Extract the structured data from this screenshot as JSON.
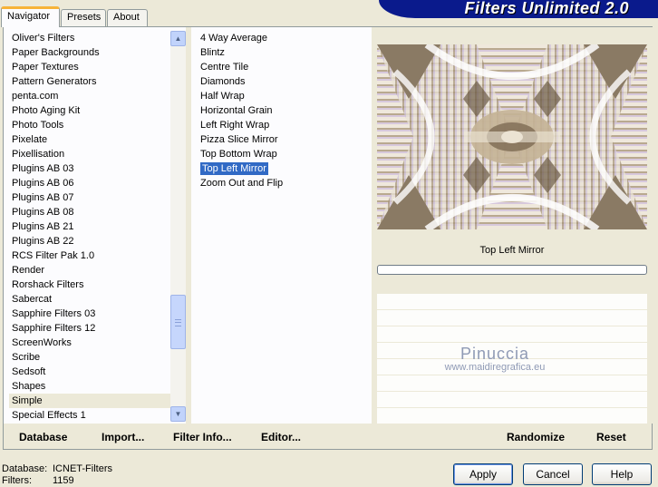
{
  "window": {
    "title": "Filters Unlimited 2.0"
  },
  "tabs": [
    {
      "label": "Navigator",
      "active": true
    },
    {
      "label": "Presets",
      "active": false
    },
    {
      "label": "About",
      "active": false
    }
  ],
  "categories": [
    "Oliver's Filters",
    "Paper Backgrounds",
    "Paper Textures",
    "Pattern Generators",
    "penta.com",
    "Photo Aging Kit",
    "Photo Tools",
    "Pixelate",
    "Pixellisation",
    "Plugins AB 03",
    "Plugins AB 06",
    "Plugins AB 07",
    "Plugins AB 08",
    "Plugins AB 21",
    "Plugins AB 22",
    "RCS Filter Pak 1.0",
    "Render",
    "Rorshack Filters",
    "Sabercat",
    "Sapphire Filters 03",
    "Sapphire Filters 12",
    "ScreenWorks",
    "Scribe",
    "Sedsoft",
    "Shapes",
    "Simple",
    "Special Effects 1"
  ],
  "selected_category": "Simple",
  "filters": [
    "4 Way Average",
    "Blintz",
    "Centre Tile",
    "Diamonds",
    "Half Wrap",
    "Horizontal Grain",
    "Left Right Wrap",
    "Pizza Slice Mirror",
    "Top Bottom Wrap",
    "Top Left Mirror",
    "Zoom Out and Flip"
  ],
  "selected_filter": "Top Left Mirror",
  "preview": {
    "effect_name": "Top Left Mirror",
    "progress": 0,
    "watermark_title": "Pinuccia",
    "watermark_url": "www.maidiregrafica.eu"
  },
  "bottom_buttons": {
    "database": "Database",
    "import": "Import...",
    "filter_info": "Filter Info...",
    "editor": "Editor...",
    "randomize": "Randomize",
    "reset": "Reset"
  },
  "status": {
    "database_label": "Database:",
    "database_value": "ICNET-Filters",
    "filters_label": "Filters:",
    "filters_value": "1159"
  },
  "dialog_buttons": {
    "apply": "Apply",
    "cancel": "Cancel",
    "help": "Help"
  },
  "icons": {
    "scroll_up": "scroll-up-icon",
    "scroll_down": "scroll-down-icon"
  },
  "colors": {
    "banner": "#0a1a8c",
    "selection": "#316ac5",
    "face": "#ece9d8",
    "tab_highlight": "#f7b338"
  }
}
